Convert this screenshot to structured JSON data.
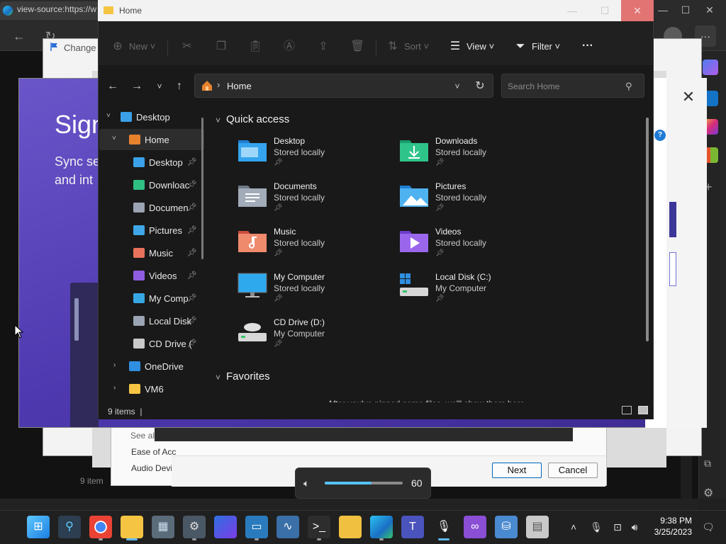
{
  "edge": {
    "tab_title": "view-source:https://w",
    "minimize": "—",
    "maximize": "☐",
    "close": "✕",
    "more": "···"
  },
  "background": {
    "change_title": "Change S",
    "signin_title": "Sign",
    "signin_sub_line1": "Sync se",
    "signin_sub_line2": "and int",
    "help": "?",
    "dialog_close": "✕"
  },
  "settings_dialog": {
    "see_all": "See al",
    "ease_of_access": "Ease of Acc",
    "audio_devices": "Audio Devi",
    "next": "Next",
    "cancel": "Cancel",
    "bg_items": "9 item"
  },
  "explorer": {
    "title": "Home",
    "toolbar": {
      "new": "New",
      "sort": "Sort",
      "view": "View",
      "filter": "Filter",
      "more": "···"
    },
    "address": "Home",
    "search_placeholder": "Search Home",
    "tree": [
      {
        "label": "Desktop",
        "color": "#3aa0e8"
      },
      {
        "label": "Home",
        "color": "#e6822e"
      },
      {
        "label": "Desktop",
        "color": "#3aa0e8"
      },
      {
        "label": "Downloac",
        "color": "#2fbf85"
      },
      {
        "label": "Documen",
        "color": "#9aa4b2"
      },
      {
        "label": "Pictures",
        "color": "#3fa7e8"
      },
      {
        "label": "Music",
        "color": "#e8725b"
      },
      {
        "label": "Videos",
        "color": "#8f5de0"
      },
      {
        "label": "My Comp",
        "color": "#37a7e4"
      },
      {
        "label": "Local Disk",
        "color": "#9aa4b2"
      },
      {
        "label": "CD Drive (",
        "color": "#c8c8c8"
      },
      {
        "label": "OneDrive",
        "color": "#2f8fe0"
      },
      {
        "label": "VM6",
        "color": "#f5c443"
      }
    ],
    "sections": {
      "quick_access": "Quick access",
      "favorites": "Favorites"
    },
    "quick_access": [
      {
        "name": "Desktop",
        "sub": "Stored locally",
        "icon": "desktop-folder-icon"
      },
      {
        "name": "Downloads",
        "sub": "Stored locally",
        "icon": "downloads-folder-icon"
      },
      {
        "name": "Documents",
        "sub": "Stored locally",
        "icon": "documents-folder-icon"
      },
      {
        "name": "Pictures",
        "sub": "Stored locally",
        "icon": "pictures-folder-icon"
      },
      {
        "name": "Music",
        "sub": "Stored locally",
        "icon": "music-folder-icon"
      },
      {
        "name": "Videos",
        "sub": "Stored locally",
        "icon": "videos-folder-icon"
      },
      {
        "name": "My Computer",
        "sub": "Stored locally",
        "icon": "computer-icon"
      },
      {
        "name": "Local Disk (C:)",
        "sub": "My Computer",
        "icon": "local-disk-icon"
      },
      {
        "name": "CD Drive (D:)",
        "sub": "My Computer",
        "icon": "cd-drive-icon"
      }
    ],
    "favorites_text": "After you've pinned some files, we'll show them here.",
    "status": "9 items"
  },
  "volume": {
    "value": "60",
    "level": 0.6
  },
  "taskbar": {
    "time": "9:38 PM",
    "date": "3/25/2023"
  }
}
